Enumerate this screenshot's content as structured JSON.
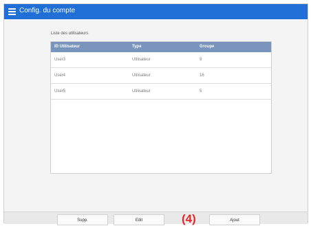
{
  "header": {
    "title": "Config. du compte"
  },
  "list": {
    "title": "Liste des utilisateurs",
    "columns": [
      "ID Utilisateur",
      "Type",
      "Groupe"
    ],
    "rows": [
      {
        "id": "User3",
        "type": "Utilisateur",
        "group": "9"
      },
      {
        "id": "User4",
        "type": "Utilisateur",
        "group": "16"
      },
      {
        "id": "User5",
        "type": "Utilisateur",
        "group": "5"
      }
    ]
  },
  "footer": {
    "delete_label": "Supp.",
    "edit_label": "Edit",
    "add_label": "Ajout"
  },
  "callout": {
    "label": "(4)"
  },
  "colors": {
    "titlebar": "#1f6fd6",
    "table_header": "#7a95bd",
    "callout": "#e6252b"
  }
}
